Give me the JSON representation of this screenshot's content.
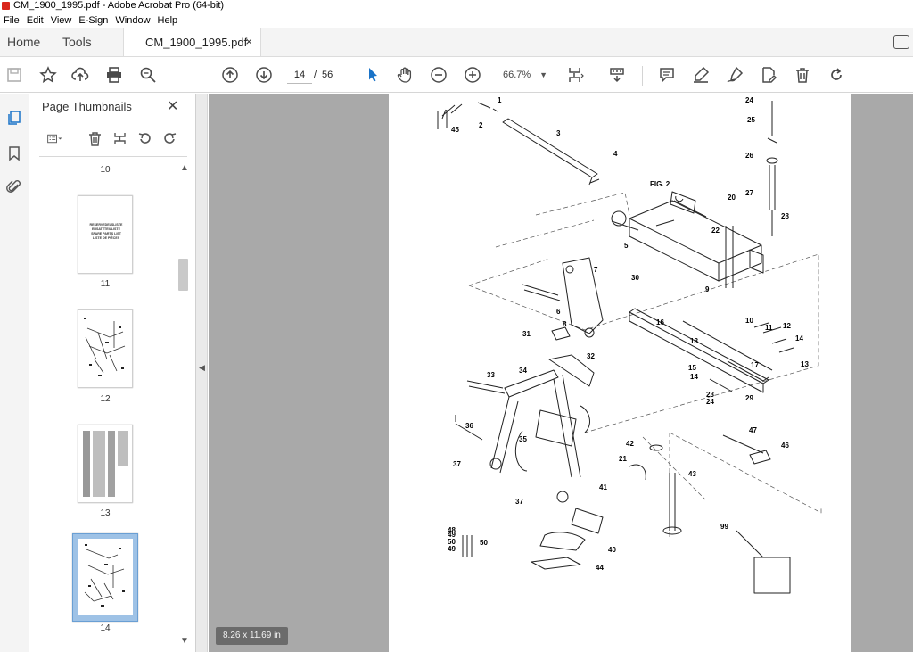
{
  "window": {
    "title": "CM_1900_1995.pdf - Adobe Acrobat Pro (64-bit)"
  },
  "menu": [
    "File",
    "Edit",
    "View",
    "E-Sign",
    "Window",
    "Help"
  ],
  "tabs": {
    "home": "Home",
    "tools": "Tools",
    "document": "CM_1900_1995.pdf",
    "close": "×"
  },
  "toolbar": {
    "current_page": "14",
    "separator": "/",
    "total_pages": "56",
    "zoom": "66.7%",
    "icons": [
      "save-icon",
      "bookmark-star-icon",
      "upload-icon",
      "print-icon",
      "search-zoom-icon",
      "page-up-icon",
      "page-down-icon",
      "select-cursor-icon",
      "hand-icon",
      "zoom-out-icon",
      "zoom-in-icon",
      "page-fit-icon",
      "scroll-mode-icon",
      "comment-icon",
      "highlight-icon",
      "sign-icon",
      "edit-icon",
      "delete-icon",
      "redo-icon"
    ]
  },
  "panel": {
    "title": "Page Thumbnails",
    "close": "✕",
    "thumbs": [
      {
        "label": "10"
      },
      {
        "label": "11",
        "lines": [
          "RESERVEDELSLISTE",
          "ERSATZTEILLISTE",
          "SPARE PARTS LIST",
          "LISTE DE PIÈCES"
        ]
      },
      {
        "label": "12"
      },
      {
        "label": "13"
      },
      {
        "label": "14"
      }
    ]
  },
  "canvas": {
    "page_size": "8.26 x 11.69 in",
    "callouts": [
      "1",
      "2",
      "3",
      "4",
      "5",
      "6",
      "7",
      "8",
      "9",
      "10",
      "11",
      "12",
      "13",
      "14",
      "14",
      "15",
      "16",
      "17",
      "18",
      "20",
      "21",
      "22",
      "23",
      "24",
      "24",
      "25",
      "26",
      "27",
      "28",
      "29",
      "30",
      "31",
      "32",
      "33",
      "34",
      "35",
      "36",
      "37",
      "37",
      "40",
      "41",
      "42",
      "43",
      "44",
      "45",
      "46",
      "47",
      "48",
      "49",
      "49",
      "50",
      "50",
      "99",
      "FIG. 2"
    ]
  },
  "colors": {
    "accent_tab": "#ffffff",
    "canvas_bg": "#a9a9a9",
    "title_icon": "#d9261c",
    "selected_thumb": "#9ec2e6"
  }
}
